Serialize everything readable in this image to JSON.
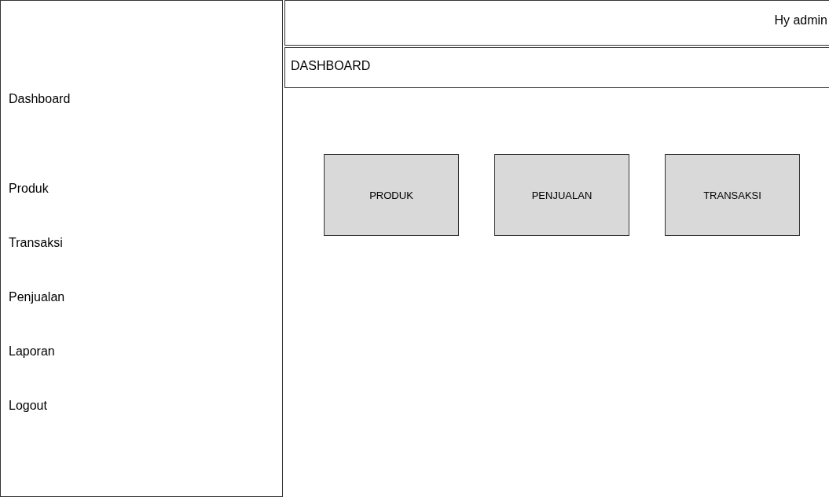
{
  "sidebar": {
    "items": [
      {
        "label": "Dashboard"
      },
      {
        "label": "Produk"
      },
      {
        "label": "Transaksi"
      },
      {
        "label": "Penjualan"
      },
      {
        "label": "Laporan"
      },
      {
        "label": "Logout"
      }
    ]
  },
  "header": {
    "greeting": "Hy admin"
  },
  "page_title": "DASHBOARD",
  "cards": [
    {
      "label": "PRODUK"
    },
    {
      "label": "PENJUALAN"
    },
    {
      "label": "TRANSAKSI"
    }
  ]
}
